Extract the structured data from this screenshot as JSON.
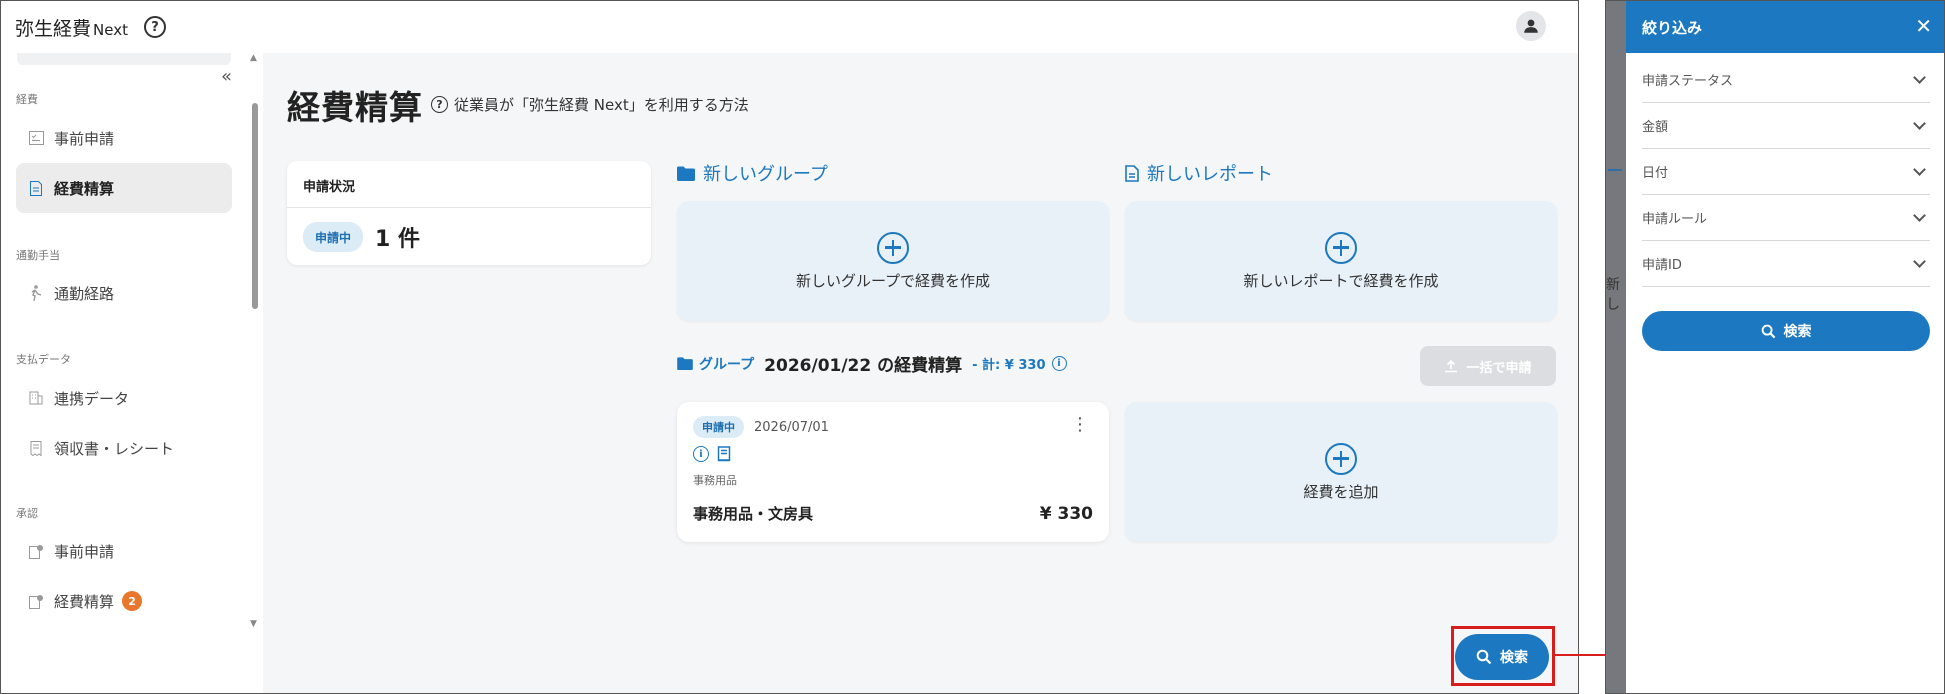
{
  "app": {
    "brand": "弥生経費",
    "brand_sub": "Next",
    "help_icon_label": "?"
  },
  "sidebar": {
    "sections": [
      {
        "title": "経費",
        "items": [
          {
            "label": "事前申請"
          },
          {
            "label": "経費精算",
            "active": true
          }
        ]
      },
      {
        "title": "通勤手当",
        "items": [
          {
            "label": "通勤経路"
          }
        ]
      },
      {
        "title": "支払データ",
        "items": [
          {
            "label": "連携データ"
          },
          {
            "label": "領収書・レシート"
          }
        ]
      },
      {
        "title": "承認",
        "items": [
          {
            "label": "事前申請"
          },
          {
            "label": "経費精算",
            "badge": "2"
          }
        ]
      }
    ]
  },
  "main": {
    "title": "経費精算",
    "help_link": "従業員が「弥生経費 Next」を利用する方法",
    "status": {
      "header": "申請状況",
      "pill": "申請中",
      "count": "1 件"
    },
    "new_group": {
      "title": "新しいグループ",
      "card_label": "新しいグループで経費を作成"
    },
    "new_report": {
      "title": "新しいレポート",
      "card_label": "新しいレポートで経費を作成"
    },
    "group": {
      "label": "グループ",
      "title": "2026/01/22 の経費精算",
      "total": "- 計: ¥ 330",
      "bulk_button": "一括で申請"
    },
    "expense": {
      "status": "申請中",
      "date": "2026/07/01",
      "category": "事務用品",
      "name": "事務用品・文房具",
      "amount": "¥ 330"
    },
    "add_expense": "経費を追加",
    "fab_label": "検索"
  },
  "drawer": {
    "title": "絞り込み",
    "filters": [
      "申請ステータス",
      "金額",
      "日付",
      "申請ルール",
      "申請ID"
    ],
    "search_button": "検索",
    "behind_text": "新し"
  },
  "colors": {
    "accent": "#1c78c0",
    "highlight": "#d91d1d",
    "badge": "#e8762b"
  }
}
